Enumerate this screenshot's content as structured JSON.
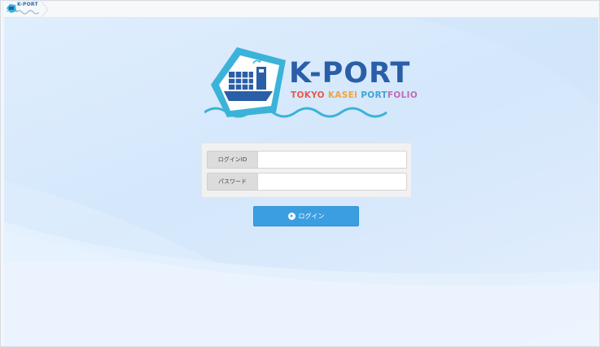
{
  "app": {
    "mini_logo_text": "K-PORT"
  },
  "logo": {
    "title": "K-PORT",
    "subtitle_parts": [
      {
        "text": "TOKYO ",
        "color": "#e8574f"
      },
      {
        "text": "KASEI ",
        "color": "#f2a33a"
      },
      {
        "text": "PORT",
        "color": "#3aa7d8"
      },
      {
        "text": "FOLIO",
        "color": "#c36ab8"
      }
    ]
  },
  "form": {
    "login_id_label": "ログインID",
    "login_id_value": "",
    "login_id_placeholder": "",
    "password_label": "パスワード",
    "password_value": "",
    "password_placeholder": "",
    "login_button_label": "ログイン"
  },
  "colors": {
    "brand_blue": "#2a5fa8",
    "button_blue": "#3b9ee0",
    "logo_cyan": "#3bb3d9",
    "background": "#d8e9fc"
  },
  "icons": {
    "login_button_icon": "circle-arrow-right-icon",
    "logo_icon": "container-ship-icon"
  }
}
